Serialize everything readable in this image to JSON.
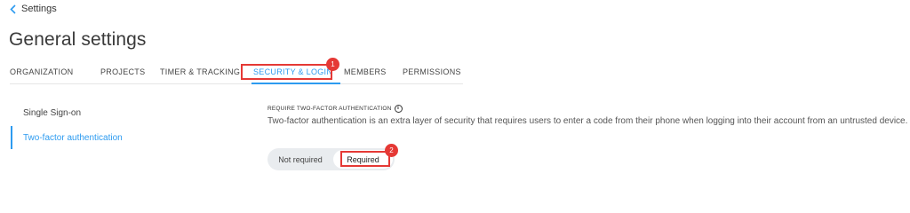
{
  "header": {
    "back_label": "Settings",
    "title": "General settings"
  },
  "tabs": [
    {
      "label": "ORGANIZATION"
    },
    {
      "label": "PROJECTS"
    },
    {
      "label": "TIMER & TRACKING"
    },
    {
      "label": "SECURITY & LOGIN",
      "active": true
    },
    {
      "label": "MEMBERS"
    },
    {
      "label": "PERMISSIONS"
    }
  ],
  "sidebar": {
    "items": [
      {
        "label": "Single Sign-on"
      },
      {
        "label": "Two-factor authentication",
        "active": true
      }
    ]
  },
  "section": {
    "label": "REQUIRE TWO-FACTOR AUTHENTICATION",
    "info_icon": "info-icon",
    "description": "Two-factor authentication is an extra layer of security that requires users to enter a code from their phone when logging into their account from an untrusted device.",
    "toggle": {
      "options": [
        "Not required",
        "Required"
      ],
      "selected": "Required"
    }
  },
  "annotations": {
    "badge_1": "1",
    "badge_2": "2"
  },
  "colors": {
    "accent": "#2d9bf0",
    "highlight": "#e53935"
  }
}
